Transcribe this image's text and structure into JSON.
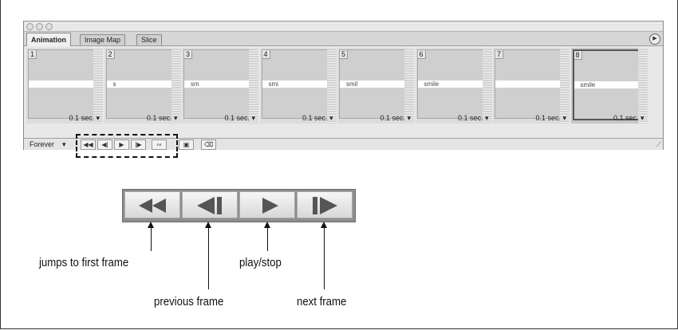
{
  "tabs": [
    "Animation",
    "Image Map",
    "Slice"
  ],
  "frames": [
    {
      "number": "1",
      "text": "",
      "delay": "0.1 sec. ▾"
    },
    {
      "number": "2",
      "text": "s",
      "delay": "0.1 sec. ▾"
    },
    {
      "number": "3",
      "text": "sm",
      "delay": "0.1 sec. ▾"
    },
    {
      "number": "4",
      "text": "smi",
      "delay": "0.1 sec. ▾"
    },
    {
      "number": "5",
      "text": "smil",
      "delay": "0.1 sec. ▾"
    },
    {
      "number": "6",
      "text": "smile",
      "delay": "0.1 sec. ▾"
    },
    {
      "number": "7",
      "text": "",
      "delay": "0.1 sec. ▾"
    },
    {
      "number": "8",
      "text": "smile",
      "delay": "0.1 sec. ▾",
      "selected": true
    }
  ],
  "controls": {
    "loop_label": "Forever",
    "buttons": [
      "first-frame",
      "previous-frame",
      "play",
      "next-frame",
      "tween",
      "new-frame",
      "delete-frame"
    ]
  },
  "callouts": {
    "first": "jumps to first frame",
    "previous": "previous frame",
    "play": "play/stop",
    "next": "next frame"
  }
}
